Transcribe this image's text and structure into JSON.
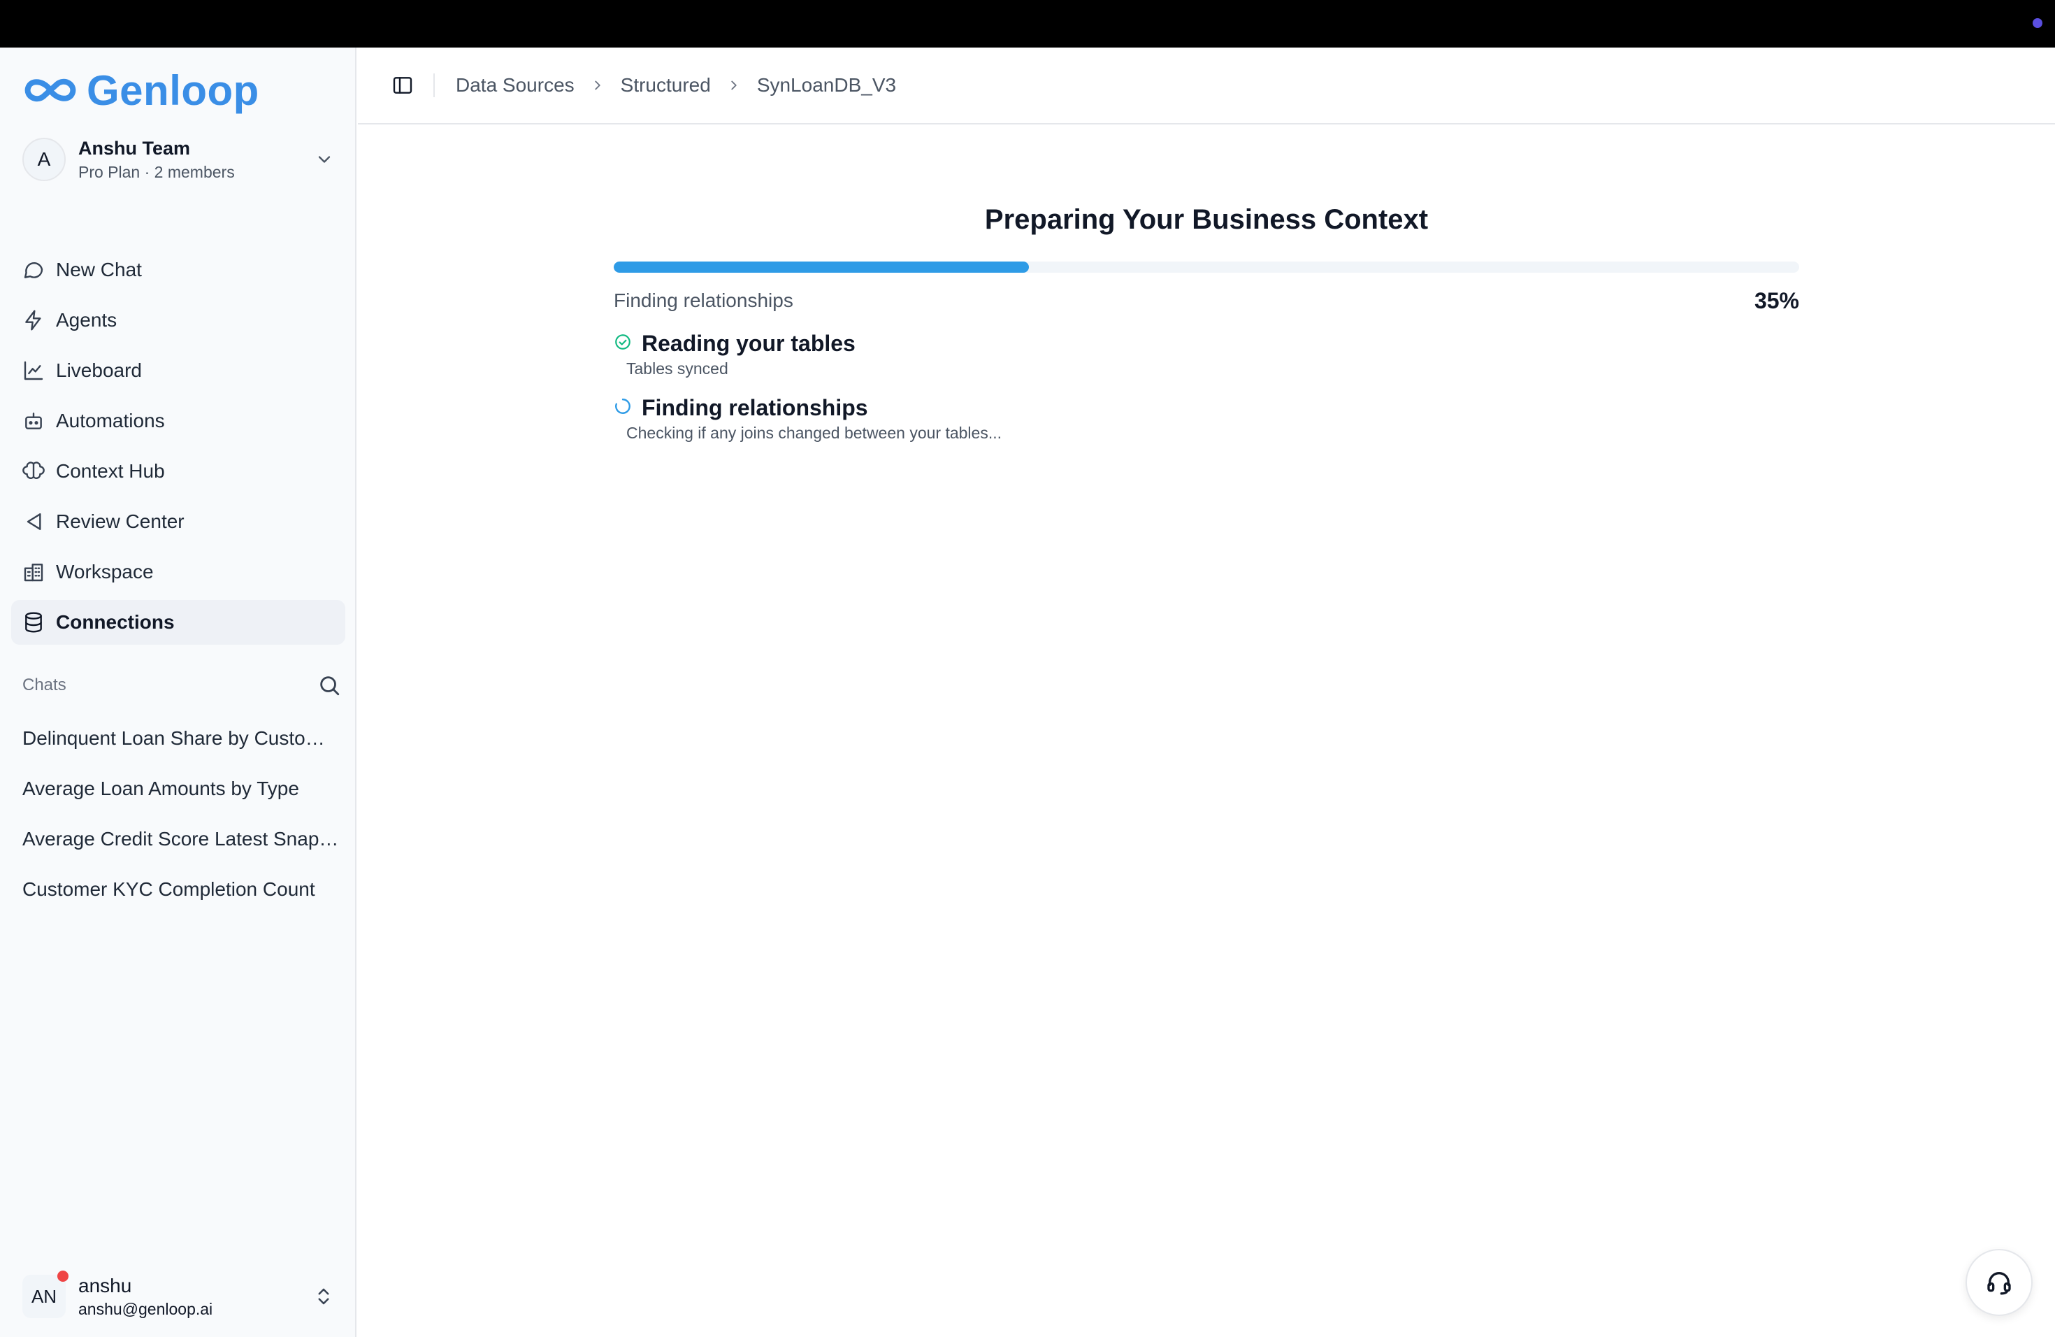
{
  "brand": {
    "name": "Genloop",
    "color": "#3a8ee6"
  },
  "team": {
    "avatar_letter": "A",
    "name": "Anshu Team",
    "plan": "Pro Plan · 2 members"
  },
  "nav": [
    {
      "label": "New Chat",
      "icon": "message-circle-icon",
      "active": false
    },
    {
      "label": "Agents",
      "icon": "zap-icon",
      "active": false
    },
    {
      "label": "Liveboard",
      "icon": "chart-icon",
      "active": false
    },
    {
      "label": "Automations",
      "icon": "bot-icon",
      "active": false
    },
    {
      "label": "Context Hub",
      "icon": "brain-icon",
      "active": false
    },
    {
      "label": "Review Center",
      "icon": "send-icon",
      "active": false
    },
    {
      "label": "Workspace",
      "icon": "building-icon",
      "active": false
    },
    {
      "label": "Connections",
      "icon": "database-icon",
      "active": true
    }
  ],
  "chats": {
    "title": "Chats",
    "items": [
      "Delinquent Loan Share by Customer Segment",
      "Average Loan Amounts by Type",
      "Average Credit Score Latest Snapshot",
      "Customer KYC Completion Count"
    ]
  },
  "user": {
    "initials": "AN",
    "name": "anshu",
    "email": "anshu@genloop.ai"
  },
  "breadcrumb": [
    "Data Sources",
    "Structured",
    "SynLoanDB_V3"
  ],
  "main": {
    "title": "Preparing Your Business Context",
    "progress_label": "Finding relationships",
    "progress_percent_text": "35%",
    "progress_value": 0.35,
    "steps": [
      {
        "title": "Reading your tables",
        "subtitle": "Tables synced",
        "status": "done",
        "icon": "check-circle-icon"
      },
      {
        "title": "Finding relationships",
        "subtitle": "Checking if any joins changed between your tables...",
        "status": "in-progress",
        "icon": "spinner-icon"
      }
    ]
  },
  "colors": {
    "accent": "#2e9be6",
    "done": "#10b981",
    "notification": "#ef4444"
  }
}
